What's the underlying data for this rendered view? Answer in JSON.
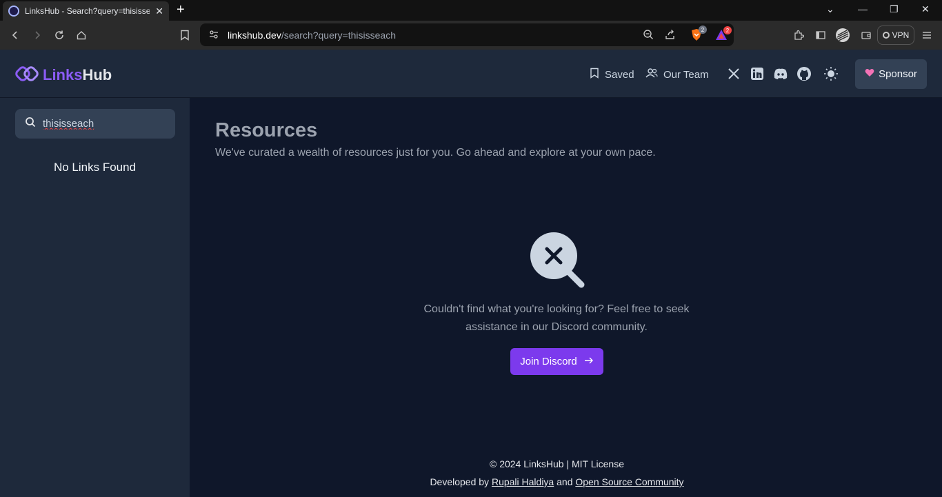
{
  "browser": {
    "tab_title": "LinksHub - Search?query=thisisseach",
    "url_host": "linkshub.dev",
    "url_path": "/search?query=thisisseach",
    "vpn_label": "VPN",
    "brave_badge": "2",
    "rewards_badge": "2"
  },
  "header": {
    "logo_links": "Links",
    "logo_hub": "Hub",
    "nav": [
      {
        "label": "Saved",
        "icon": "bookmark-icon"
      },
      {
        "label": "Our Team",
        "icon": "team-icon"
      }
    ],
    "social_icons": [
      "x-icon",
      "linkedin-icon",
      "discord-icon",
      "github-icon",
      "theme-toggle-icon"
    ],
    "sponsor_label": "Sponsor"
  },
  "sidebar": {
    "search_value": "thisisseach",
    "no_results": "No Links Found"
  },
  "main": {
    "title": "Resources",
    "subtitle": "We've curated a wealth of resources just for you. Go ahead and explore at your own pace.",
    "empty_message": "Couldn't find what you're looking for? Feel free to seek assistance in our Discord community.",
    "discord_button": "Join Discord"
  },
  "footer": {
    "line1": "© 2024 LinksHub | MIT License",
    "developed_by": "Developed by",
    "author": "Rupali Haldiya",
    "and": "and",
    "community": "Open Source Community"
  },
  "colors": {
    "accent": "#7c3aed",
    "background": "#0f172a",
    "panel": "#1e293b"
  }
}
